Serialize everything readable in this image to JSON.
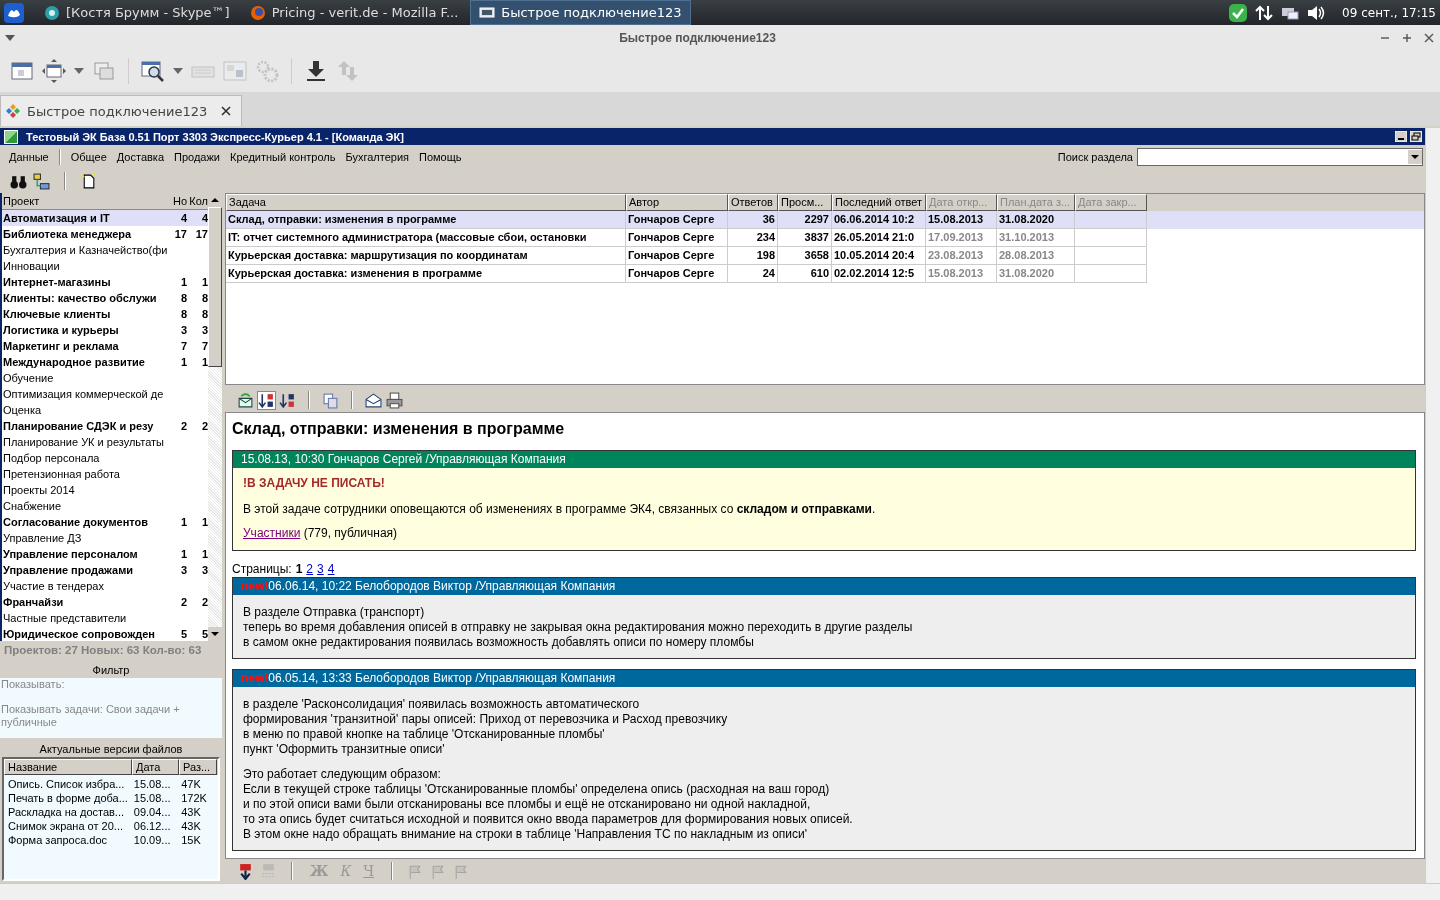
{
  "taskbar": {
    "tasks": [
      {
        "label": "[Костя Брумм - Skype™]",
        "kind": "chat",
        "selected": false
      },
      {
        "label": "Pricing - verit.de - Mozilla F...",
        "kind": "browser",
        "selected": false
      },
      {
        "label": "Быстрое подключение123",
        "kind": "remote",
        "selected": true
      }
    ],
    "clock": "09 сент., 17:15"
  },
  "window": {
    "title": "Быстрое подключение123"
  },
  "tab": {
    "label": "Быстрое подключение123"
  },
  "app": {
    "title": "Тестовый ЭК База 0.51 Порт 3303 Экспресс-Курьер 4.1 - [Команда ЭК]"
  },
  "menu": [
    "Данные",
    "Общее",
    "Доставка",
    "Продажи",
    "Кредитный контроль",
    "Бухгалтерия",
    "Помощь"
  ],
  "search": {
    "label": "Поиск раздела"
  },
  "projects": {
    "columns": [
      "Проект",
      "Но",
      "Кол"
    ],
    "rows": [
      {
        "name": "Автоматизация и IT",
        "new": "4",
        "count": "4",
        "selected": true
      },
      {
        "name": "Библиотека менеджера",
        "new": "17",
        "count": "17",
        "selected": false
      },
      {
        "name": "Бухгалтерия и Казначейство(фи",
        "selected": false
      },
      {
        "name": "Инновации",
        "selected": false
      },
      {
        "name": "Интернет-магазины",
        "new": "1",
        "count": "1",
        "selected": false
      },
      {
        "name": "Клиенты: качество обслужи",
        "new": "8",
        "count": "8",
        "selected": false
      },
      {
        "name": "Ключевые клиенты",
        "new": "8",
        "count": "8",
        "selected": false
      },
      {
        "name": "Логистика и курьеры",
        "new": "3",
        "count": "3",
        "selected": false
      },
      {
        "name": "Маркетинг и реклама",
        "new": "7",
        "count": "7",
        "selected": false
      },
      {
        "name": "Международное развитие",
        "new": "1",
        "count": "1",
        "selected": false
      },
      {
        "name": "Обучение",
        "selected": false
      },
      {
        "name": "Оптимизация коммерческой де",
        "selected": false
      },
      {
        "name": "Оценка",
        "selected": false
      },
      {
        "name": "Планирование СДЭК и резу",
        "new": "2",
        "count": "2",
        "selected": false
      },
      {
        "name": "Планирование УК и результаты",
        "selected": false
      },
      {
        "name": "Подбор персонала",
        "selected": false
      },
      {
        "name": "Претензионная работа",
        "selected": false
      },
      {
        "name": "Проекты 2014",
        "selected": false
      },
      {
        "name": "Снабжение",
        "selected": false
      },
      {
        "name": "Согласование документов",
        "new": "1",
        "count": "1",
        "selected": false
      },
      {
        "name": "Управление ДЗ",
        "selected": false
      },
      {
        "name": "Управление персоналом",
        "new": "1",
        "count": "1",
        "selected": false
      },
      {
        "name": "Управление продажами",
        "new": "3",
        "count": "3",
        "selected": false
      },
      {
        "name": "Участие в тендерах",
        "selected": false
      },
      {
        "name": "Франчайзи",
        "new": "2",
        "count": "2",
        "selected": false
      },
      {
        "name": "Частные представители",
        "selected": false
      },
      {
        "name": "Юридическое сопровожден",
        "new": "5",
        "count": "5",
        "selected": false
      }
    ],
    "summary": "Проектов: 27 Новых: 63  Кол-во: 63"
  },
  "filter": {
    "title": "Фильтр",
    "lines": [
      "Показывать:",
      "Показывать задачи: Свои задачи + публичные"
    ]
  },
  "files": {
    "title": "Актуальные версии файлов",
    "columns": [
      "Название",
      "Дата",
      "Раз..."
    ],
    "rows": [
      [
        "Опись. Список избра...",
        "15.08...",
        "47K"
      ],
      [
        "Печать в форме доба...",
        "15.08...",
        "172K"
      ],
      [
        "Раскладка на достав...",
        "09.04...",
        "43K"
      ],
      [
        "Снимок экрана от 20...",
        "06.12...",
        "43K"
      ],
      [
        "Форма запроса.doc",
        "10.09...",
        "15K"
      ]
    ]
  },
  "tasks": {
    "columns": [
      {
        "label": "Задача",
        "muted": false
      },
      {
        "label": "Автор",
        "muted": false
      },
      {
        "label": "Ответов",
        "muted": false
      },
      {
        "label": "Просм...",
        "muted": false
      },
      {
        "label": "Последний ответ",
        "muted": false
      },
      {
        "label": "Дата откр...",
        "muted": true
      },
      {
        "label": "План.дата з...",
        "muted": true
      },
      {
        "label": "Дата закр...",
        "muted": true
      }
    ],
    "rows": [
      {
        "cells": [
          "Склад, отправки: изменения в программе",
          "Гончаров Серге",
          "36",
          "2297",
          "06.06.2014 10:2",
          "15.08.2013",
          "31.08.2020"
        ],
        "selected": true
      },
      {
        "cells": [
          "IT: отчет системного администратора (массовые сбои, остановки",
          "Гончаров Серге",
          "234",
          "3837",
          "26.05.2014 21:0",
          "17.09.2013",
          "31.10.2013"
        ],
        "selected": false
      },
      {
        "cells": [
          "Курьерская доставка: маршрутизация по координатам",
          "Гончаров Серге",
          "198",
          "3658",
          "10.05.2014 20:4",
          "23.08.2013",
          "28.08.2013"
        ],
        "selected": false
      },
      {
        "cells": [
          "Курьерская доставка: изменения в программе",
          "Гончаров Серге",
          "24",
          "610",
          "02.02.2014 12:5",
          "15.08.2013",
          "31.08.2020"
        ],
        "selected": false
      }
    ]
  },
  "detail": {
    "title": "Склад, отправки: изменения в программе",
    "posts": [
      {
        "kind": "note",
        "header": "15.08.13, 10:30 Гончаров Сергей /Управляющая Компания",
        "warning": "!В ЗАДАЧУ НЕ ПИСАТЬ!",
        "text": "В этой задаче сотрудники оповещаются об изменениях в программе ЭК4, связанных со **складом и отправками**.",
        "link": "Участники",
        "link_note": " (779, публичная)"
      },
      {
        "kind": "reply",
        "badge": "new!",
        "header": "06.06.14, 10:22 Белобородов Виктор /Управляющая Компания",
        "paragraphs": [
          [
            "В разделе Отправка (транспорт)",
            "теперь во время добавления описей в отправку не закрывая окна редактирования можно переходить в другие разделы",
            "в самом окне редактирования появилась возможность добавлять описи по номеру пломбы"
          ]
        ]
      },
      {
        "kind": "reply",
        "badge": "new!",
        "header": "06.05.14, 13:33 Белобородов Виктор /Управляющая Компания",
        "paragraphs": [
          [
            "в разделе 'Расконсолидация' появилась возможность автоматического",
            "формирования 'транзитной' пары описей: Приход от перевозчика и Расход превозчику",
            "в меню по правой кнопке на таблице 'Отсканированные пломбы'",
            "пункт 'Оформить транзитные описи'"
          ],
          [
            "Это работает следующим образом:",
            "Если в текущей строке таблицы 'Отсканированные пломбы' определена опись (расходная на ваш город)",
            "и по этой описи вами были отсканированы все пломбы и ещё не отсканировано ни одной накладной,",
            "то эта опись будет считаться исходной и появится окно ввода параметров для формирования новых описей.",
            "В этом окне надо обращать внимание на строки в таблице 'Направления ТС по накладным из описи'"
          ]
        ]
      }
    ],
    "pages_label": "Страницы:",
    "pages": [
      {
        "label": "1",
        "selected": true
      },
      {
        "label": "2",
        "selected": false
      },
      {
        "label": "3",
        "selected": false
      },
      {
        "label": "4",
        "selected": false
      }
    ]
  },
  "format_buttons": [
    {
      "label": "Ж",
      "kind": "bold",
      "disabled": true
    },
    {
      "label": "К",
      "kind": "italic",
      "disabled": true
    },
    {
      "label": "Ч",
      "kind": "underline",
      "disabled": true
    }
  ]
}
